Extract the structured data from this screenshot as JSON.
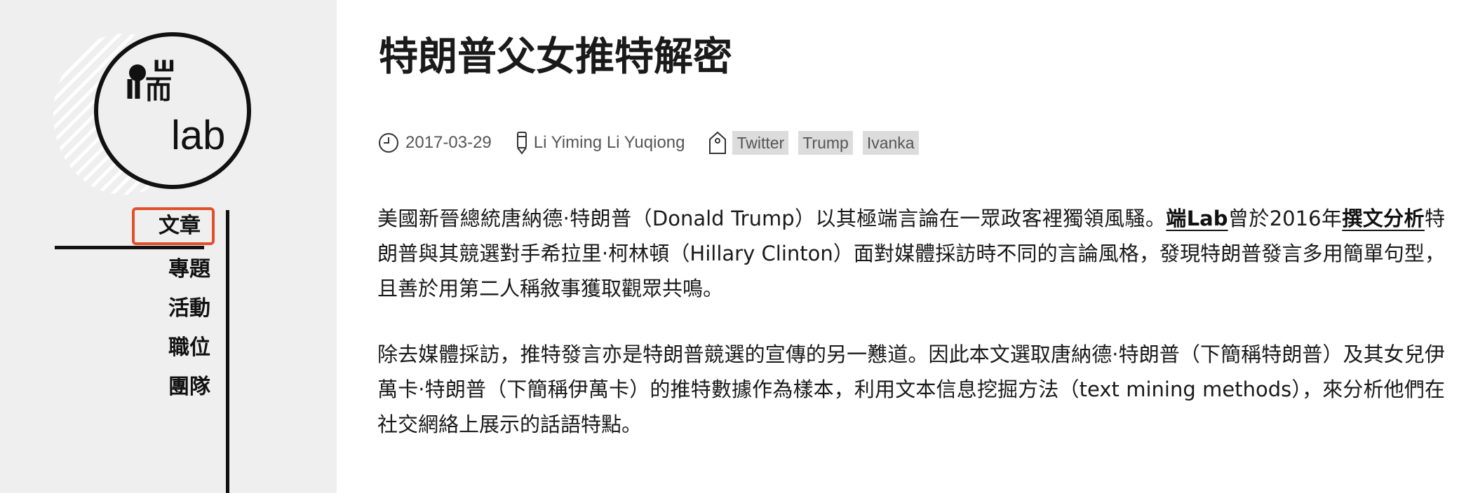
{
  "logo": {
    "glyph_top": "ш",
    "glyph_bottom": "Ⅱ而",
    "lab": "lab"
  },
  "nav": {
    "items": [
      {
        "label": "文章",
        "active": true
      },
      {
        "label": "專題"
      },
      {
        "label": "活動"
      },
      {
        "label": "職位"
      },
      {
        "label": "團隊"
      }
    ]
  },
  "article": {
    "title": "特朗普父女推特解密",
    "date": "2017-03-29",
    "authors": "Li Yiming Li Yuqiong",
    "tags": [
      "Twitter",
      "Trump",
      "Ivanka"
    ],
    "p1": {
      "text1": "美國新晉總統唐納德·特朗普（Donald Trump）以其極端言論在一眾政客裡獨領風騷。",
      "link1": "端Lab",
      "text2": "曾於2016年",
      "link2": "撰文分析",
      "text3": "特朗普與其競選對手希拉里·柯林頓（Hillary Clinton）面對媒體採訪時不同的言論風格，發現特朗普發言多用簡單句型，且善於用第二人稱敘事獲取觀眾共鳴。"
    },
    "p2": "除去媒體採訪，推特發言亦是特朗普競選的宣傳的另一戁道。因此本文選取唐納德·特朗普（下簡稱特朗普）及其女兒伊萬卡·特朗普（下簡稱伊萬卡）的推特數據作為樣本，利用文本信息挖掘方法（text mining methods），來分析他們在社交網絡上展示的話語特點。"
  },
  "icons": {
    "date": "clock-icon",
    "author": "pen-icon",
    "tags": "tag-icon"
  },
  "colors": {
    "sidebar_bg": "#efefef",
    "active_outline": "#e0502c",
    "tag_bg": "#dcdcdc"
  }
}
